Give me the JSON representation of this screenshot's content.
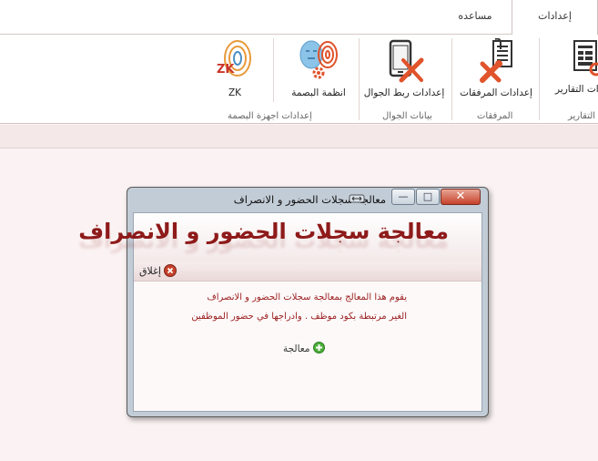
{
  "tabs": [
    {
      "label": "إعدادات البرنامج",
      "active": true
    },
    {
      "label": "مساعده",
      "active": false
    }
  ],
  "ribbon": {
    "buttons": {
      "reports": "إعدادات التقارير",
      "attachments": "إعدادات المرفقات",
      "mobile_link": "إعدادات ربط الجوال",
      "fingerprint_systems": "انظمة البصمة",
      "zk": "ZK"
    },
    "groups": {
      "reports": "التقارير",
      "attachments": "المرفقات",
      "mobile_data": "بيانات الجوال",
      "fingerprint_devices": "إعدادات اجهزة البصمة"
    }
  },
  "dialog": {
    "title": "معالجة سجلات الحضور و الانصراف",
    "heading": "معالجة سجلات الحضور و الانصراف",
    "close_label": "إغلاق",
    "description_line1": "يقوم هذا المعالج بمعالجة سجلات الحضور و الانصراف",
    "description_line2": "الغير مرتبطة بكود موظف . وادراجها في حضور الموظفين",
    "process_label": "معالجة"
  },
  "colors": {
    "accent_red": "#8e1a1a",
    "close_button": "#c6412a",
    "process_icon": "#4caf3a"
  },
  "icons": [
    "report-icon",
    "attachment-tools-icon",
    "mobile-tools-icon",
    "face-fingerprint-icon",
    "zk-fingerprint-icon",
    "close-icon",
    "move-icon",
    "add-icon"
  ]
}
